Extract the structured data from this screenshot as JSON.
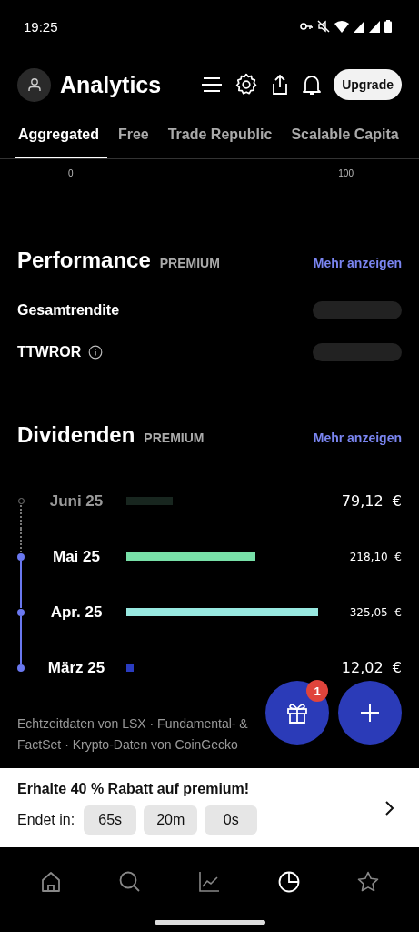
{
  "status_bar": {
    "time": "19:25"
  },
  "header": {
    "title": "Analytics",
    "upgrade_label": "Upgrade"
  },
  "tabs": [
    {
      "label": "Aggregated",
      "selected": true
    },
    {
      "label": "Free",
      "selected": false
    },
    {
      "label": "Trade Republic",
      "selected": false
    },
    {
      "label": "Scalable Capita",
      "selected": false
    }
  ],
  "axis_labels": [
    "0",
    "100"
  ],
  "performance": {
    "title": "Performance",
    "badge": "PREMIUM",
    "more_link": "Mehr anzeigen",
    "rows": [
      {
        "label": "Gesamtrendite",
        "info": false
      },
      {
        "label": "TTWROR",
        "info": true
      }
    ]
  },
  "dividends": {
    "title": "Dividenden",
    "badge": "PREMIUM",
    "more_link": "Mehr anzeigen",
    "rows": [
      {
        "month": "Juni 25",
        "amount": "79,12  €",
        "color": "#18261f",
        "paid": false,
        "kind": "large"
      },
      {
        "month": "Mai 25",
        "amount": "218,10  €",
        "color": "#78e0a8",
        "paid": true,
        "kind": "small"
      },
      {
        "month": "Apr. 25",
        "amount": "325,05  €",
        "color": "#98e8e0",
        "paid": true,
        "kind": "small"
      },
      {
        "month": "März 25",
        "amount": "12,02  €",
        "color": "#2a3cc0",
        "paid": true,
        "kind": "large"
      }
    ]
  },
  "footer_lines": [
    "Echtzeitdaten von LSX · Fundamental- &",
    "FactSet · Krypto-Daten von CoinGecko"
  ],
  "gift_badge": "1",
  "promo": {
    "title": "Erhalte 40 % Rabatt auf premium!",
    "ends_label": "Endet in:",
    "timer": [
      "65s",
      "20m",
      "0s"
    ]
  },
  "nav": [
    {
      "selected": false
    },
    {
      "selected": false
    },
    {
      "selected": false
    },
    {
      "selected": true
    },
    {
      "selected": false
    }
  ]
}
